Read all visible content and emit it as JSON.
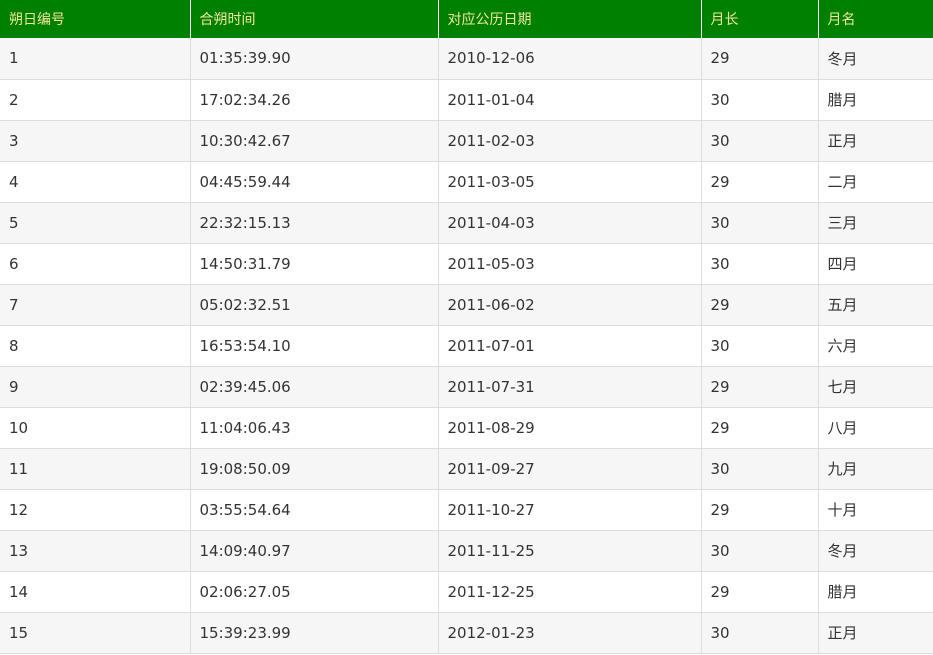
{
  "table": {
    "headers": [
      "朔日编号",
      "合朔时间",
      "对应公历日期",
      "月长",
      "月名"
    ],
    "rows": [
      [
        "1",
        "01:35:39.90",
        "2010-12-06",
        "29",
        "冬月"
      ],
      [
        "2",
        "17:02:34.26",
        "2011-01-04",
        "30",
        "腊月"
      ],
      [
        "3",
        "10:30:42.67",
        "2011-02-03",
        "30",
        "正月"
      ],
      [
        "4",
        "04:45:59.44",
        "2011-03-05",
        "29",
        "二月"
      ],
      [
        "5",
        "22:32:15.13",
        "2011-04-03",
        "30",
        "三月"
      ],
      [
        "6",
        "14:50:31.79",
        "2011-05-03",
        "30",
        "四月"
      ],
      [
        "7",
        "05:02:32.51",
        "2011-06-02",
        "29",
        "五月"
      ],
      [
        "8",
        "16:53:54.10",
        "2011-07-01",
        "30",
        "六月"
      ],
      [
        "9",
        "02:39:45.06",
        "2011-07-31",
        "29",
        "七月"
      ],
      [
        "10",
        "11:04:06.43",
        "2011-08-29",
        "29",
        "八月"
      ],
      [
        "11",
        "19:08:50.09",
        "2011-09-27",
        "30",
        "九月"
      ],
      [
        "12",
        "03:55:54.64",
        "2011-10-27",
        "29",
        "十月"
      ],
      [
        "13",
        "14:09:40.97",
        "2011-11-25",
        "30",
        "冬月"
      ],
      [
        "14",
        "02:06:27.05",
        "2011-12-25",
        "29",
        "腊月"
      ],
      [
        "15",
        "15:39:23.99",
        "2012-01-23",
        "30",
        "正月"
      ]
    ]
  },
  "colors": {
    "header_bg": "#008000",
    "header_text": "#f0e6a0",
    "row_alt_bg": "#f6f6f6"
  }
}
